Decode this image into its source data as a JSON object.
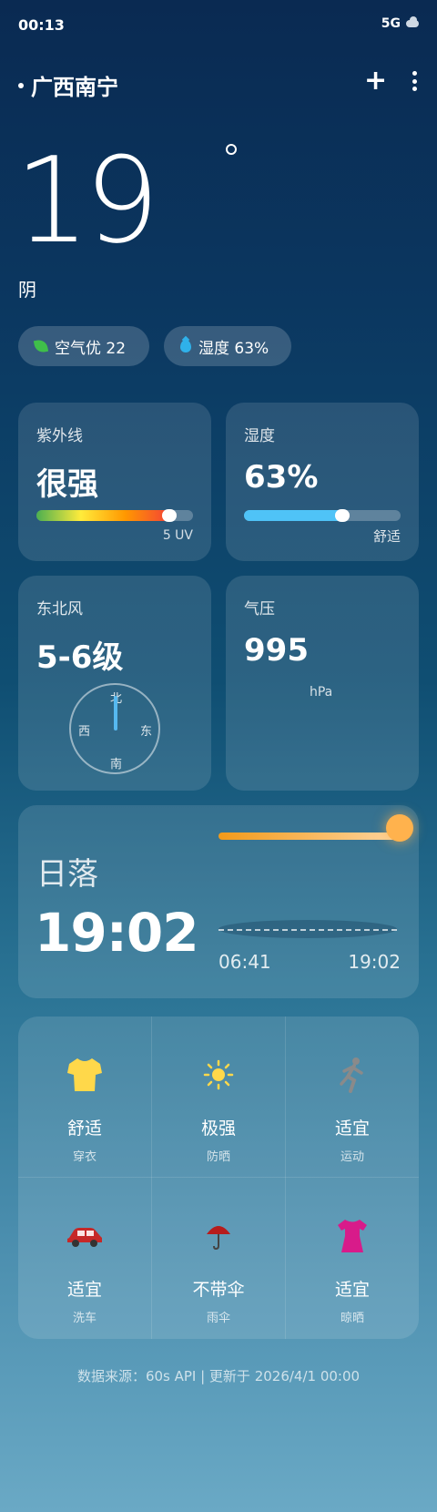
{
  "status": {
    "time": "00:13",
    "network": "5G",
    "network_icon": "cloud-icon"
  },
  "header": {
    "location": "广西南宁",
    "add": "+",
    "more_icon": "more-vertical-icon"
  },
  "current": {
    "temperature": "19",
    "condition": "阴"
  },
  "chips": {
    "air": {
      "label": "空气优 22",
      "icon": "leaf-icon"
    },
    "humidity": {
      "label": "湿度 63%",
      "icon": "water-drop-icon"
    }
  },
  "uv": {
    "title": "紫外线",
    "level": "很强",
    "unit": "5 UV",
    "fill_percent": 85,
    "colors": [
      "#4caf50",
      "#ffeb3b",
      "#ff9800",
      "#f44336"
    ]
  },
  "humidity": {
    "title": "湿度",
    "value": "63%",
    "desc": "舒适",
    "fill_percent": 63,
    "color": "#4fc3f7"
  },
  "wind": {
    "title": "东北风",
    "level": "5-6级",
    "north": "北",
    "south": "南",
    "east": "东",
    "west": "西"
  },
  "pressure": {
    "title": "气压",
    "value": "995",
    "unit": "hPa"
  },
  "sunset": {
    "title": "日落",
    "time": "19:02",
    "sunrise": "06:41",
    "sunset": "19:02"
  },
  "life": [
    {
      "icon": "shirt-icon",
      "value": "舒适",
      "label": "穿衣",
      "color": "#ffd84a"
    },
    {
      "icon": "sun-icon",
      "value": "极强",
      "label": "防晒",
      "color": "#ffd84a"
    },
    {
      "icon": "running-icon",
      "value": "适宜",
      "label": "运动",
      "color": "#8a8a8a"
    },
    {
      "icon": "car-icon",
      "value": "适宜",
      "label": "洗车",
      "color": "#c62828"
    },
    {
      "icon": "umbrella-icon",
      "value": "不带伞",
      "label": "雨伞",
      "color": "#b71c1c"
    },
    {
      "icon": "dress-icon",
      "value": "适宜",
      "label": "晾晒",
      "color": "#d81b8a"
    }
  ],
  "footer": "数据来源：60s API | 更新于 2026/4/1 00:00"
}
